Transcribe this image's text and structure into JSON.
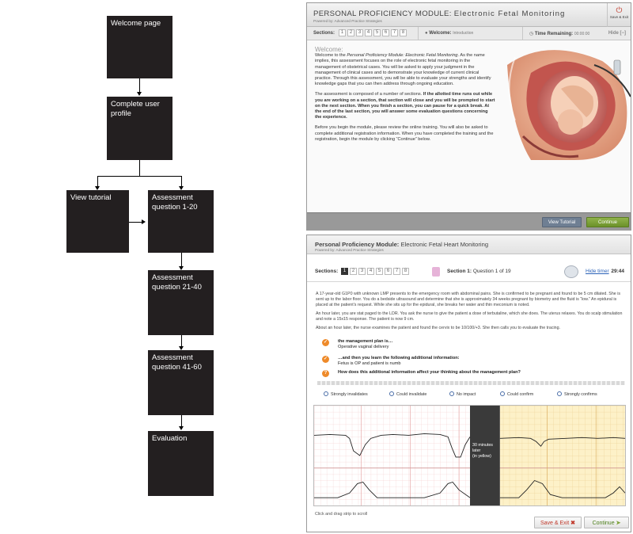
{
  "flowchart": {
    "welcome": "Welcome page",
    "profile": "Complete user profile",
    "tutorial": "View tutorial",
    "q1": "Assessment question 1-20",
    "q2": "Assessment question 21-40",
    "q3": "Assessment question 41-60",
    "eval": "Evaluation"
  },
  "screen1": {
    "title_prefix": "PERSONAL PROFICIENCY MODULE:",
    "title_main": "Electronic Fetal Monitoring",
    "powered": "Powered by: Advanced Practice Strategies",
    "save_exit": "Save & Exit",
    "sections_label": "Sections:",
    "sections": [
      "1",
      "2",
      "3",
      "4",
      "5",
      "6",
      "7",
      "8"
    ],
    "welcome_label": "Welcome:",
    "welcome_value": "Introduction",
    "time_label": "Time Remaining:",
    "time_value": "00:00:00",
    "hide": "Hide [−]",
    "heading": "Welcome:",
    "para1_a": "Welcome to the ",
    "para1_em": "Personal Proficiency Module: Electronic Fetal Monitoring",
    "para1_b": ". As the name implies, this assessment focuses on the role of electronic fetal monitoring in the management of obstetrical cases. You will be asked to apply your judgment in the management of clinical cases and to demonstrate your knowledge of current clinical practice. Through this assessment, you will be able to evaluate your strengths and identify knowledge gaps that you can then address through ongoing education.",
    "para2_a": "The assessment is composed of a number of sections. ",
    "para2_b": "If the allotted time runs out while you are working on a section, that section will close and you will be prompted to start on the next section. When you finish a section, you can pause for a quick break. At the end of the last section, you will answer some evaluation questions concerning the experience.",
    "para3": "Before you begin the module, please review the online training. You will also be asked to complete additional registration information. When you have completed the training and the registration, begin the module by clicking “Continue” below.",
    "btn_tutorial": "View Tutorial",
    "btn_continue": "Continue"
  },
  "screen2": {
    "title_prefix": "Personal Proficiency Module:",
    "title_main": "Electronic Fetal Heart Monitoring",
    "powered": "Powered by: Advanced Practice Strategies",
    "sections_label": "Sections:",
    "sections": [
      "1",
      "2",
      "3",
      "4",
      "5",
      "6",
      "7",
      "8"
    ],
    "section_label": "Section 1:",
    "section_value": "Question 1 of 19",
    "hide_timer": "Hide timer",
    "timer": "29:44",
    "case1": "A 17-year-old G1P0 with unknown LMP presents to the emergency room with abdominal pains. She is confirmed to be pregnant and found to be 5 cm dilated. She is sent up to the labor floor. You do a bedside ultrasound and determine that she is approximately 34 weeks pregnant by biometry and the fluid is “low.” An epidural is placed at the patient’s request. While she sits up for the epidural, she breaks her water and thin meconium is noted.",
    "case2": "An hour later, you are stat paged to the LDR. You ask the nurse to give the patient a dose of terbutaline, which she does. The uterus relaxes. You do scalp stimulation and note a 15x15 response. The patient is now 9 cm.",
    "case3": "About an hour later, the nurse examines the patient and found the cervix to be 10/100/+3. She then calls you to evaluate the tracing.",
    "q1_label": "the management plan is…",
    "q1_value": "Operative vaginal delivery",
    "q2_label": "…and then you learn the following additional information:",
    "q2_value": "Fetus is OP and patient is numb",
    "q3_label": "How does this additional information affect your thinking about the management plan?",
    "options": [
      "Strongly invalidates",
      "Could invalidate",
      "No impact",
      "Could confirm",
      "Strongly confirms"
    ],
    "gap_line1": "30 minutes",
    "gap_line2": "later",
    "gap_line3": "(in yellow)",
    "hint": "Click and drag strip to scroll",
    "btn_save": "Save & Exit",
    "btn_continue": "Continue"
  },
  "colors": {
    "accent_green": "#7ea33a",
    "tutorial_blue": "#6f7f93",
    "warning_orange": "#ee8a2a",
    "grid_red": "#e7a7a7",
    "grid_yellow_bg": "#fdf1c8"
  }
}
